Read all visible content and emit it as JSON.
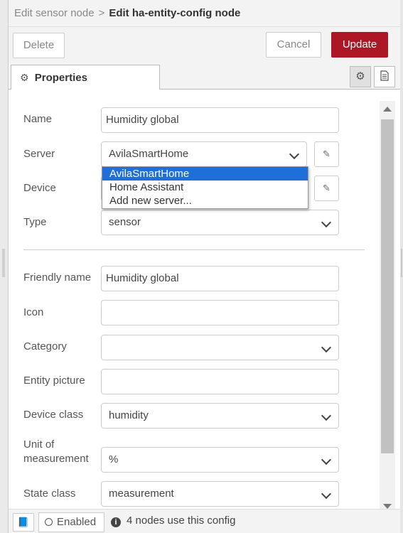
{
  "breadcrumb": {
    "parent": "Edit sensor node",
    "separator": ">",
    "current": "Edit ha-entity-config node"
  },
  "toolbar": {
    "delete_label": "Delete",
    "cancel_label": "Cancel",
    "update_label": "Update"
  },
  "colors": {
    "update_button": "#ad1625",
    "dropdown_selected": "#1e6fd9"
  },
  "tabs": {
    "properties_label": "Properties",
    "icons": [
      "gear-icon",
      "document-icon"
    ]
  },
  "form": {
    "name": {
      "label": "Name",
      "value": "Humidity global"
    },
    "server": {
      "label": "Server",
      "value": "AvilaSmartHome"
    },
    "device": {
      "label": "Device",
      "value": ""
    },
    "type": {
      "label": "Type",
      "value": "sensor"
    },
    "friendly_name": {
      "label": "Friendly name",
      "value": "Humidity global"
    },
    "icon": {
      "label": "Icon",
      "value": ""
    },
    "category": {
      "label": "Category",
      "value": ""
    },
    "entity_picture": {
      "label": "Entity picture",
      "value": ""
    },
    "device_class": {
      "label": "Device class",
      "value": "humidity"
    },
    "unit_of_measurement": {
      "label_line1": "Unit of",
      "label_line2": "measurement",
      "value": "%"
    },
    "state_class": {
      "label": "State class",
      "value": "measurement"
    }
  },
  "server_dropdown": {
    "options": [
      "AvilaSmartHome",
      "Home Assistant",
      "Add new server..."
    ],
    "selected": "AvilaSmartHome"
  },
  "footer": {
    "enabled_label": "Enabled",
    "info_text": "4 nodes use this config"
  }
}
